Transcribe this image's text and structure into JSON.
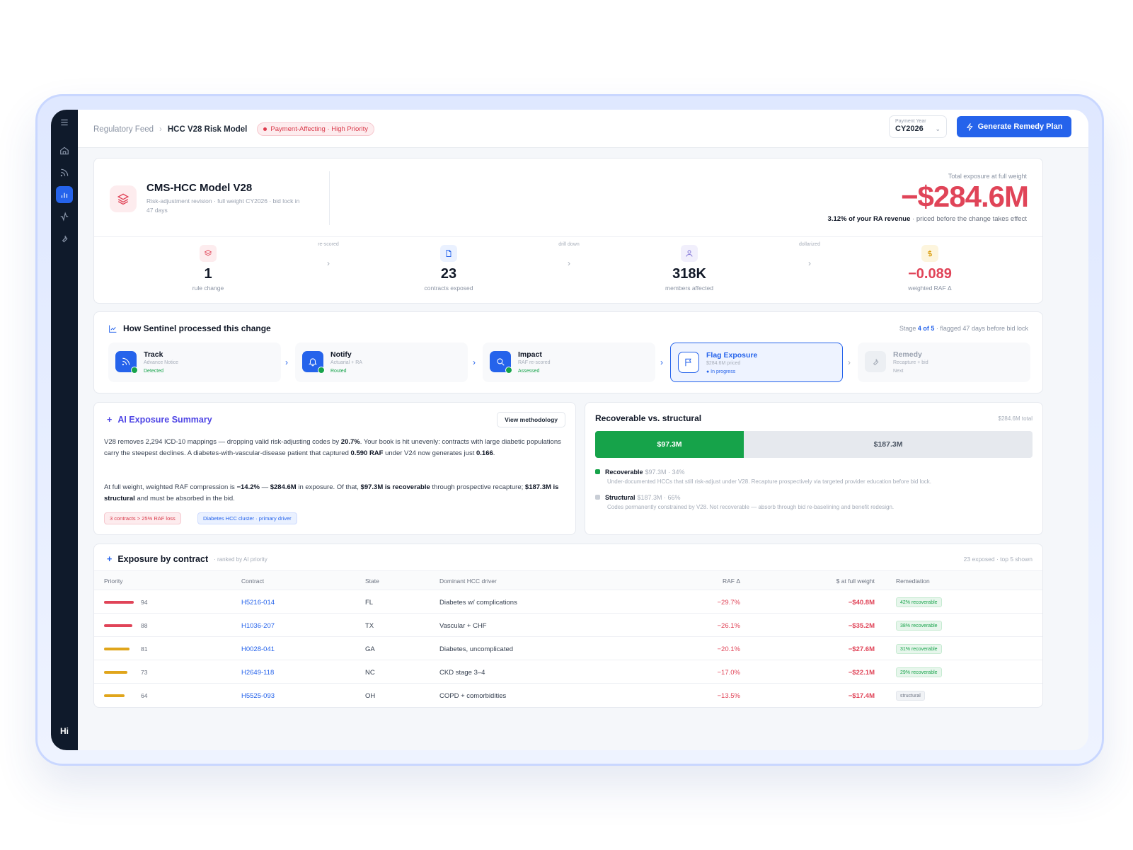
{
  "breadcrumb": {
    "parent": "Regulatory Feed",
    "current": "HCC V28 Risk Model",
    "badge": "Payment-Affecting · High Priority"
  },
  "year_select": {
    "label": "Payment Year",
    "value": "CY2026"
  },
  "primary_action": {
    "label": "Generate Remedy Plan"
  },
  "sidebar": {
    "user_initials": "Hi",
    "items": [
      "menu-icon",
      "home-icon",
      "feed-icon",
      "chart-icon",
      "activity-icon",
      "wrench-icon"
    ]
  },
  "hero": {
    "title": "CMS-HCC Model V28",
    "subtitle": "Risk-adjustment revision · full weight CY2026 · bid lock in 47 days",
    "total_label": "Total exposure at full weight",
    "total_value": "−$284.6M",
    "pct_bold": "3.12% of your RA revenue",
    "pct_rest": " · priced before the change takes effect",
    "stats": [
      {
        "value": "1",
        "label": "rule change",
        "color": "#e04458"
      },
      {
        "value": "23",
        "label": "contracts exposed",
        "color": "#2563eb"
      },
      {
        "value": "318K",
        "label": "members affected",
        "color": "#7c6fd6"
      },
      {
        "value": "−0.089",
        "label": "weighted RAF Δ",
        "color": "#d99a06"
      }
    ],
    "flows": [
      "re-scored",
      "drill down",
      "dollarized"
    ]
  },
  "pipeline": {
    "title": "How Sentinel processed this change",
    "meta_prefix": "Stage ",
    "meta_stage": "4 of 5",
    "meta_suffix": " · flagged 47 days before bid lock",
    "stages": [
      {
        "name": "Track",
        "desc": "Advance Notice",
        "status": "Detected"
      },
      {
        "name": "Notify",
        "desc": "Actuarial + RA",
        "status": "Routed"
      },
      {
        "name": "Impact",
        "desc": "RAF re-scored",
        "status": "Assessed"
      },
      {
        "name": "Flag Exposure",
        "desc": "$284.6M priced",
        "status": "● In progress"
      },
      {
        "name": "Remedy",
        "desc": "Recapture + bid",
        "status": "Next"
      }
    ]
  },
  "ai_summary": {
    "title": "AI Exposure Summary",
    "button": "View methodology",
    "p1_a": "V28 removes 2,294 ICD-10 mappings — dropping valid risk-adjusting codes by ",
    "p1_b": "20.7%",
    "p1_c": ". Your book is hit unevenly: contracts with large diabetic populations carry the steepest declines. A diabetes-with-vascular-disease patient that captured ",
    "p1_d": "0.590 RAF",
    "p1_e": " under V24 now generates just ",
    "p1_f": "0.166",
    "p1_g": ".",
    "p2_a": "At full weight, weighted RAF compression is ",
    "p2_b": "−14.2%",
    "p2_c": " — ",
    "p2_d": "$284.6M",
    "p2_e": " in exposure. Of that, ",
    "p2_f": "$97.3M is recoverable",
    "p2_g": " through prospective recapture; ",
    "p2_h": "$187.3M is structural",
    "p2_i": " and must be absorbed in the bid.",
    "tag1": "3 contracts > 25% RAF loss",
    "tag2": "Diabetes HCC cluster · primary driver"
  },
  "recoverable": {
    "title": "Recoverable vs. structural",
    "total": "$284.6M total",
    "recoverable_fraction": 0.34,
    "green_label": "$97.3M",
    "grey_label": "$187.3M",
    "legend": [
      {
        "name": "Recoverable",
        "value": "$97.3M · 34%",
        "desc": "Under-documented HCCs that still risk-adjust under V28. Recapture prospectively via targeted provider education before bid lock.",
        "color": "#16a34a"
      },
      {
        "name": "Structural",
        "value": "$187.3M · 66%",
        "desc": "Codes permanently constrained by V28. Not recoverable — absorb through bid re-baselining and benefit redesign.",
        "color": "#c9ced6"
      }
    ]
  },
  "table": {
    "title": "Exposure by contract",
    "subtitle": "· ranked by AI priority",
    "meta": "23 exposed · top 5 shown",
    "headers": {
      "priority": "Priority",
      "contract": "Contract",
      "state": "State",
      "driver": "Dominant HCC driver",
      "raf": "RAF Δ",
      "dollars": "$ at full weight",
      "remediation": "Remediation"
    },
    "rows": [
      {
        "priority": 94,
        "bar_color": "#e04458",
        "contract": "H5216-014",
        "state": "FL",
        "driver": "Diabetes w/ complications",
        "raf": "−29.7%",
        "dollars": "−$40.8M",
        "remediation": "42% recoverable",
        "type": "g"
      },
      {
        "priority": 88,
        "bar_color": "#e04458",
        "contract": "H1036-207",
        "state": "TX",
        "driver": "Vascular + CHF",
        "raf": "−26.1%",
        "dollars": "−$35.2M",
        "remediation": "38% recoverable",
        "type": "g"
      },
      {
        "priority": 81,
        "bar_color": "#e0a51b",
        "contract": "H0028-041",
        "state": "GA",
        "driver": "Diabetes, uncomplicated",
        "raf": "−20.1%",
        "dollars": "−$27.6M",
        "remediation": "31% recoverable",
        "type": "g"
      },
      {
        "priority": 73,
        "bar_color": "#e0a51b",
        "contract": "H2649-118",
        "state": "NC",
        "driver": "CKD stage 3–4",
        "raf": "−17.0%",
        "dollars": "−$22.1M",
        "remediation": "29% recoverable",
        "type": "g"
      },
      {
        "priority": 64,
        "bar_color": "#e0a51b",
        "contract": "H5525-093",
        "state": "OH",
        "driver": "COPD + comorbidities",
        "raf": "−13.5%",
        "dollars": "−$17.4M",
        "remediation": "structural",
        "type": "s"
      }
    ]
  }
}
